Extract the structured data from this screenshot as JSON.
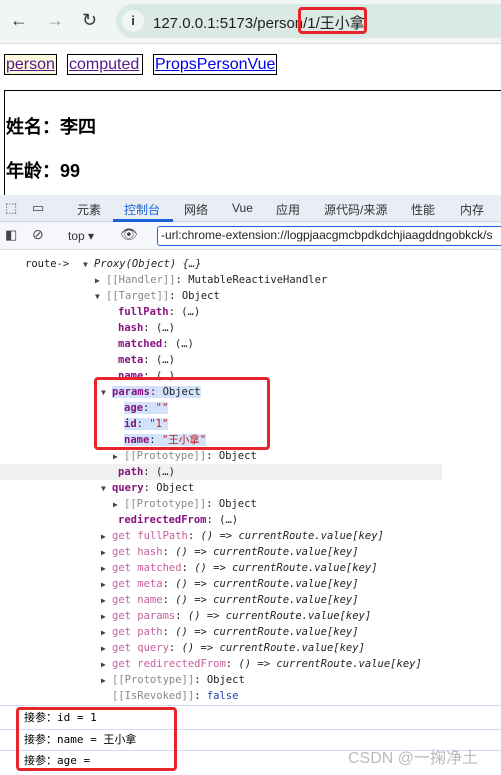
{
  "browser": {
    "url_prefix": "127.0.0.1:5173/person/",
    "url_highlight": "1/王小拿"
  },
  "nav_links": [
    "person",
    "computed",
    "PropsPersonVue"
  ],
  "page": {
    "name_line": "姓名：李四",
    "age_line": "年龄：99"
  },
  "devtools": {
    "tabs": [
      "元素",
      "控制台",
      "网络",
      "Vue",
      "应用",
      "源代码/来源",
      "性能",
      "内存"
    ],
    "active_tab": "控制台",
    "context": "top",
    "filter": "-url:chrome-extension://logpjaacgmcbpdkdchjiaagddngobkck/s",
    "accent": "#1a64d6"
  },
  "console": {
    "route_label": "route->",
    "rows": [
      {
        "indent": 0,
        "tri": "▼",
        "html": "<span class='it'>Proxy(Object) {…}</span>"
      },
      {
        "indent": 1,
        "tri": "▶",
        "html": "<span class='g'>[[Handler]]</span>: MutableReactiveHandler"
      },
      {
        "indent": 1,
        "tri": "▼",
        "html": "<span class='g'>[[Target]]</span>: Object"
      },
      {
        "indent": 2,
        "tri": "",
        "html": "<span class='k'>fullPath</span>:  (…)"
      },
      {
        "indent": 2,
        "tri": "",
        "html": "<span class='k'>hash</span>:  (…)"
      },
      {
        "indent": 2,
        "tri": "",
        "html": "<span class='k'>matched</span>:  (…)"
      },
      {
        "indent": 2,
        "tri": "",
        "html": "<span class='k'>meta</span>:  (…)"
      },
      {
        "indent": 2,
        "tri": "",
        "html": "<span class='k'>name</span>:  (…)"
      },
      {
        "indent": 1.5,
        "tri": "▼",
        "html": "<span class='sel'><span class='k'>params</span>: Object</span>"
      },
      {
        "indent": 2.5,
        "tri": "",
        "html": "<span class='sel'><span class='k'>age</span>: <span class='s'>\"\"</span></span>"
      },
      {
        "indent": 2.5,
        "tri": "",
        "html": "<span class='sel'><span class='k'>id</span>: <span class='s'>\"1\"</span></span>"
      },
      {
        "indent": 2.5,
        "tri": "",
        "html": "<span class='sel'><span class='k'>name</span>: <span class='s'>\"王小拿\"</span></span>"
      },
      {
        "indent": 2.5,
        "tri": "▶",
        "html": "<span class='g'>[[Prototype]]</span>: Object"
      },
      {
        "indent": 2,
        "tri": "",
        "html": "<span class='k'>path</span>:  (…)"
      },
      {
        "indent": 1.5,
        "tri": "▼",
        "html": "<span class='k'>query</span>: Object"
      },
      {
        "indent": 2.5,
        "tri": "▶",
        "html": "<span class='g'>[[Prototype]]</span>: Object"
      },
      {
        "indent": 2,
        "tri": "",
        "html": "<span class='k'>redirectedFrom</span>:  (…)"
      },
      {
        "indent": 1.5,
        "tri": "▶",
        "html": "<span class='gk'>get fullPath</span>: <span class='it'>() =&gt; currentRoute.value[key]</span>"
      },
      {
        "indent": 1.5,
        "tri": "▶",
        "html": "<span class='gk'>get hash</span>: <span class='it'>() =&gt; currentRoute.value[key]</span>"
      },
      {
        "indent": 1.5,
        "tri": "▶",
        "html": "<span class='gk'>get matched</span>: <span class='it'>() =&gt; currentRoute.value[key]</span>"
      },
      {
        "indent": 1.5,
        "tri": "▶",
        "html": "<span class='gk'>get meta</span>: <span class='it'>() =&gt; currentRoute.value[key]</span>"
      },
      {
        "indent": 1.5,
        "tri": "▶",
        "html": "<span class='gk'>get name</span>: <span class='it'>() =&gt; currentRoute.value[key]</span>"
      },
      {
        "indent": 1.5,
        "tri": "▶",
        "html": "<span class='gk'>get params</span>: <span class='it'>() =&gt; currentRoute.value[key]</span>"
      },
      {
        "indent": 1.5,
        "tri": "▶",
        "html": "<span class='gk'>get path</span>: <span class='it'>() =&gt; currentRoute.value[key]</span>"
      },
      {
        "indent": 1.5,
        "tri": "▶",
        "html": "<span class='gk'>get query</span>: <span class='it'>() =&gt; currentRoute.value[key]</span>"
      },
      {
        "indent": 1.5,
        "tri": "▶",
        "html": "<span class='gk'>get redirectedFrom</span>: <span class='it'>() =&gt; currentRoute.value[key]</span>"
      },
      {
        "indent": 1.5,
        "tri": "▶",
        "html": "<span class='g'>[[Prototype]]</span>: Object"
      },
      {
        "indent": 1.5,
        "tri": "",
        "html": "<span class='g'>[[IsRevoked]]</span>: <span class='b'>false</span>"
      }
    ],
    "logs": [
      "接参：id =  1",
      "接参：name =  王小拿",
      "接参：age ="
    ]
  },
  "watermark": "CSDN @一掬净土"
}
